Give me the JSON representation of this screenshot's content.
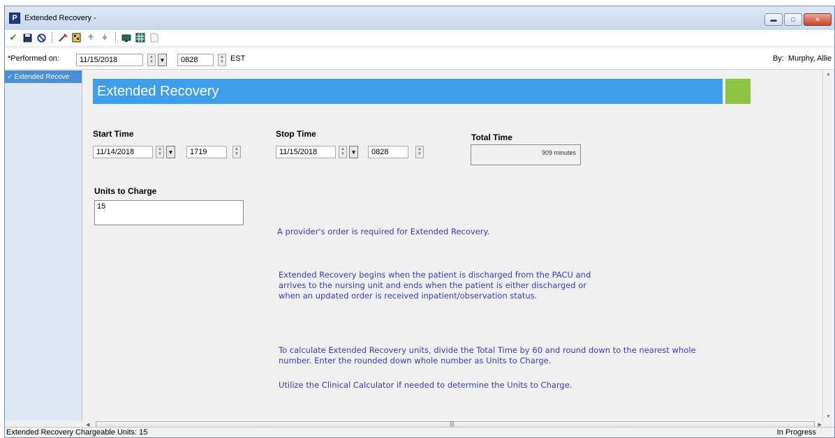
{
  "window": {
    "title": "Extended Recovery -",
    "app_icon_letter": "P",
    "controls": [
      "minimize-icon",
      "maximize-icon",
      "close-icon"
    ]
  },
  "toolbar": {
    "icons": [
      "checkmark-icon",
      "save-icon",
      "cancel-icon",
      "clear-icon",
      "form-browser-icon",
      "up-arrow-icon",
      "down-arrow-icon",
      "monitor-icon",
      "grid-icon",
      "document-icon"
    ]
  },
  "performed": {
    "label": "*Performed on:",
    "date": "11/15/2018",
    "time": "0828",
    "timezone": "EST",
    "by_label": "By:",
    "by_name": "Murphy, Allie"
  },
  "nav": {
    "items": [
      {
        "label": "Extended Recove"
      }
    ]
  },
  "form": {
    "banner_title": "Extended Recovery",
    "start_time": {
      "label": "Start Time",
      "date": "11/14/2018",
      "time": "1719"
    },
    "stop_time": {
      "label": "Stop Time",
      "date": "11/15/2018",
      "time": "0828"
    },
    "total_time": {
      "label": "Total Time",
      "value": "909 minutes"
    },
    "units": {
      "label": "Units to Charge",
      "value": "15"
    },
    "info": {
      "p1": "A provider's order is required for Extended Recovery.",
      "p2_l1": "Extended Recovery begins when the patient is discharged from the PACU and",
      "p2_l2": "arrives to the nursing unit and ends when the patient is either discharged or",
      "p2_l3": "when an updated order is received inpatient/observation status.",
      "p3_l1": "To calculate Extended Recovery units, divide the Total Time by 60 and round down to the nearest whole",
      "p3_l2": "number.  Enter the rounded down whole number as Units to Charge.",
      "p4": "Utilize the Clinical Calculator if needed to determine the Units to Charge."
    }
  },
  "status": {
    "left": "Extended Recovery Chargeable Units: 15",
    "right": "In Progress"
  },
  "colors": {
    "banner": "#3f9ee9",
    "accent_green": "#8dc343",
    "info_text": "#3a3ac8",
    "nav_selected": "#4a8ed8"
  }
}
